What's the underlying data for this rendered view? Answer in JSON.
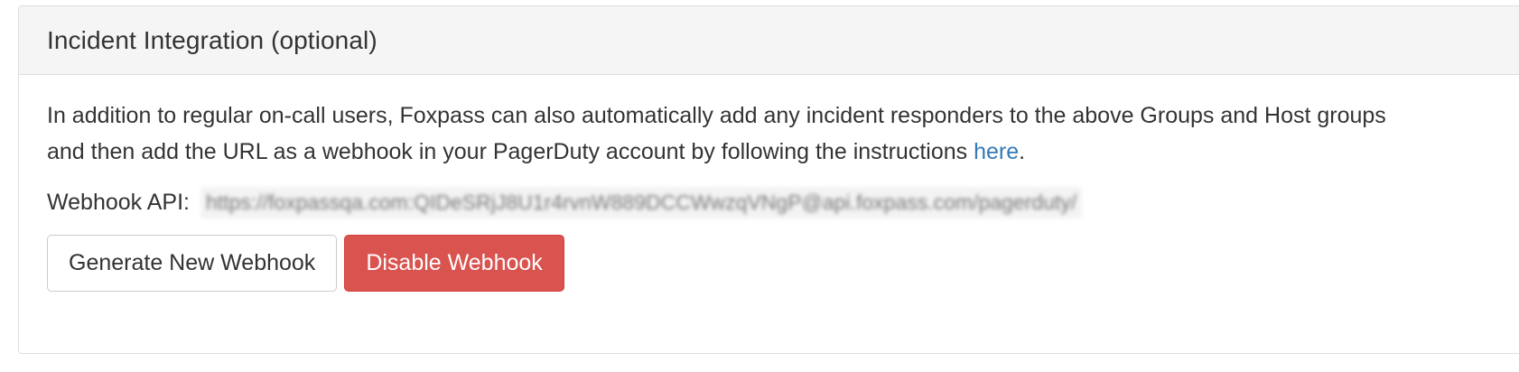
{
  "panel": {
    "title": "Incident Integration (optional)",
    "description_line1": "In addition to regular on-call users, Foxpass can also automatically add any incident responders to the above Groups and Host groups",
    "description_line2_prefix": "and then add the URL as a webhook in your PagerDuty account by following the instructions ",
    "description_link": "here",
    "description_line2_suffix": "."
  },
  "webhook": {
    "label": "Webhook API:",
    "url": "https://foxpassqa.com:QIDeSRjJ8U1r4rvnW889DCCWwzqVNgP@api.foxpass.com/pagerduty/"
  },
  "buttons": {
    "generate_label": "Generate New Webhook",
    "disable_label": "Disable Webhook"
  },
  "colors": {
    "danger": "#d9534f",
    "link": "#337ab7",
    "heading_bg": "#f5f5f5"
  }
}
